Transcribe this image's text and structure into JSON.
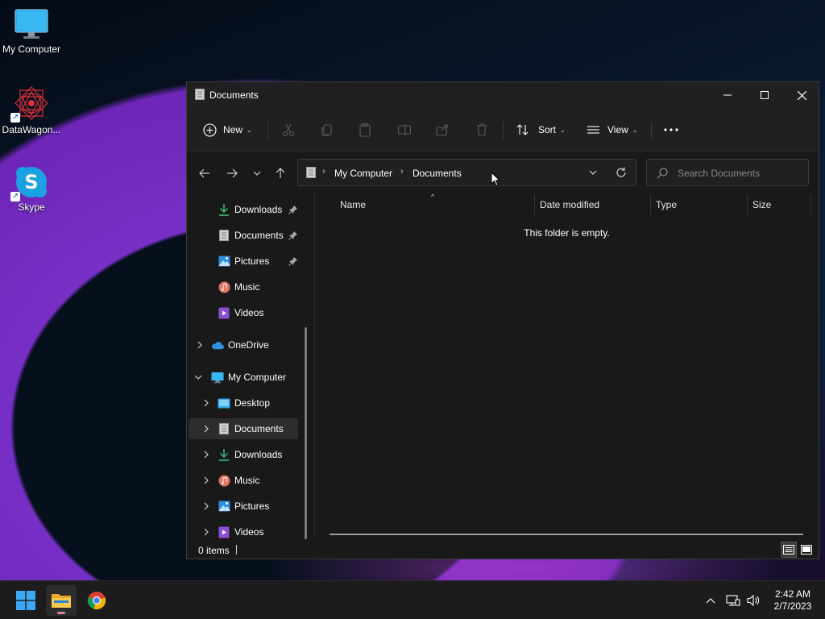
{
  "desktop": {
    "icons": [
      {
        "label": "My Computer",
        "icon": "monitor-icon"
      },
      {
        "label": "DataWagon...",
        "icon": "datawagon-icon"
      },
      {
        "label": "Skype",
        "icon": "skype-icon"
      }
    ]
  },
  "window": {
    "title": "Documents",
    "command_bar": {
      "new_label": "New",
      "sort_label": "Sort",
      "view_label": "View"
    },
    "address": {
      "crumbs": [
        "My Computer",
        "Documents"
      ],
      "search_placeholder": "Search Documents"
    },
    "nav_pane": {
      "quick_access": [
        {
          "label": "Downloads",
          "icon": "download-icon",
          "pinned": true
        },
        {
          "label": "Documents",
          "icon": "document-icon",
          "pinned": true
        },
        {
          "label": "Pictures",
          "icon": "pictures-icon",
          "pinned": true
        },
        {
          "label": "Music",
          "icon": "music-icon",
          "pinned": false
        },
        {
          "label": "Videos",
          "icon": "videos-icon",
          "pinned": false
        }
      ],
      "onedrive": "OneDrive",
      "my_computer": "My Computer",
      "my_computer_children": [
        {
          "label": "Desktop",
          "icon": "desktop-folder-icon"
        },
        {
          "label": "Documents",
          "icon": "document-icon",
          "selected": true
        },
        {
          "label": "Downloads",
          "icon": "download-icon"
        },
        {
          "label": "Music",
          "icon": "music-icon"
        },
        {
          "label": "Pictures",
          "icon": "pictures-icon"
        },
        {
          "label": "Videos",
          "icon": "videos-icon"
        }
      ]
    },
    "columns": [
      "Name",
      "Date modified",
      "Type",
      "Size"
    ],
    "empty_message": "This folder is empty.",
    "status": "0 items"
  },
  "taskbar": {
    "time": "2:42 AM",
    "date": "2/7/2023"
  },
  "colors": {
    "window_bg": "#191919",
    "titlebar_bg": "#202020",
    "accent_blue": "#4cc2ff",
    "taskbar_bg": "#1c1c1c"
  }
}
